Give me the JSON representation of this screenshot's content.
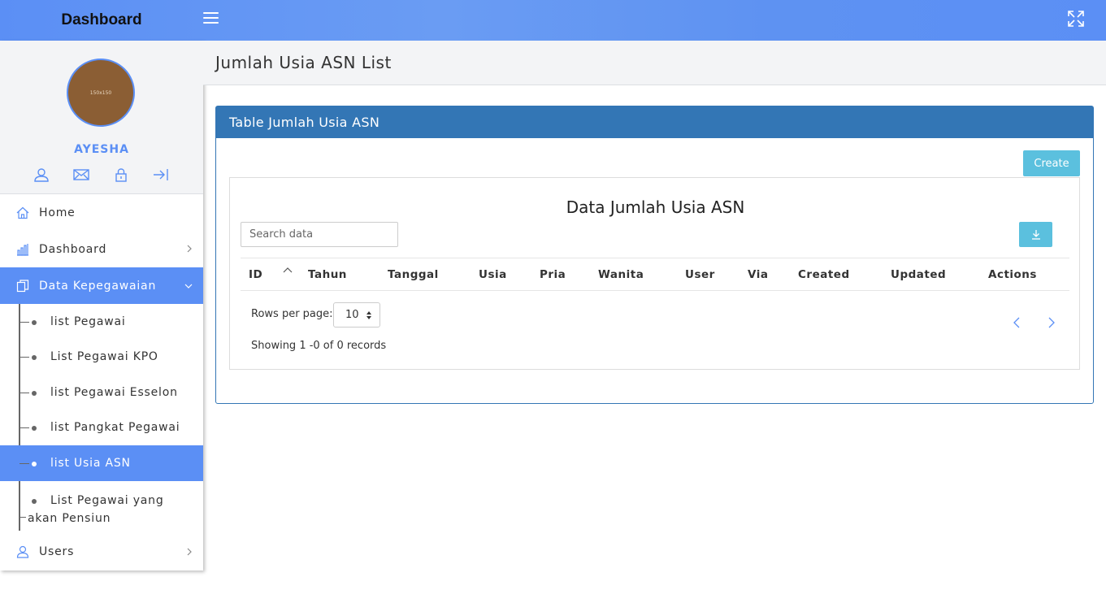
{
  "topbar": {
    "brand": "Dashboard",
    "menu_toggle_icon": "hamburger-icon",
    "fullscreen_icon": "expand-icon",
    "color": "#5b8ff5"
  },
  "profile": {
    "avatar_text": "150x150",
    "username": "AYESHA",
    "icons": [
      "user-icon",
      "mail-icon",
      "lock-icon",
      "logout-icon"
    ]
  },
  "sidebar": {
    "items": [
      {
        "label": "Home",
        "icon": "home-icon"
      },
      {
        "label": "Dashboard",
        "icon": "bar-chart-icon"
      },
      {
        "label": "Data Kepegawaian",
        "icon": "documents-icon"
      },
      {
        "label": "Users",
        "icon": "user-icon"
      }
    ],
    "subitems": [
      {
        "label": "list Pegawai"
      },
      {
        "label": "List Pegawai KPO"
      },
      {
        "label": "list Pegawai Esselon"
      },
      {
        "label": "list Pangkat Pegawai"
      },
      {
        "label": "list Usia ASN"
      },
      {
        "label": "List Pegawai yang akan Pensiun"
      }
    ],
    "active_color": "#5b8ff5"
  },
  "page": {
    "title": "Jumlah Usia ASN List"
  },
  "panel": {
    "heading": "Table Jumlah Usia ASN",
    "create_label": "Create",
    "table_title": "Data Jumlah Usia ASN",
    "search_placeholder": "Search data",
    "download_icon": "download-icon",
    "columns": [
      "ID",
      "Tahun",
      "Tanggal",
      "Usia",
      "Pria",
      "Wanita",
      "User",
      "Via",
      "Created",
      "Updated",
      "Actions"
    ],
    "rows_per_page_label": "Rows per page:",
    "rows_per_page_value": "10",
    "showing_text": "Showing 1 -0 of 0 records",
    "header_color": "#3376b5",
    "button_color": "#5bc0de"
  }
}
